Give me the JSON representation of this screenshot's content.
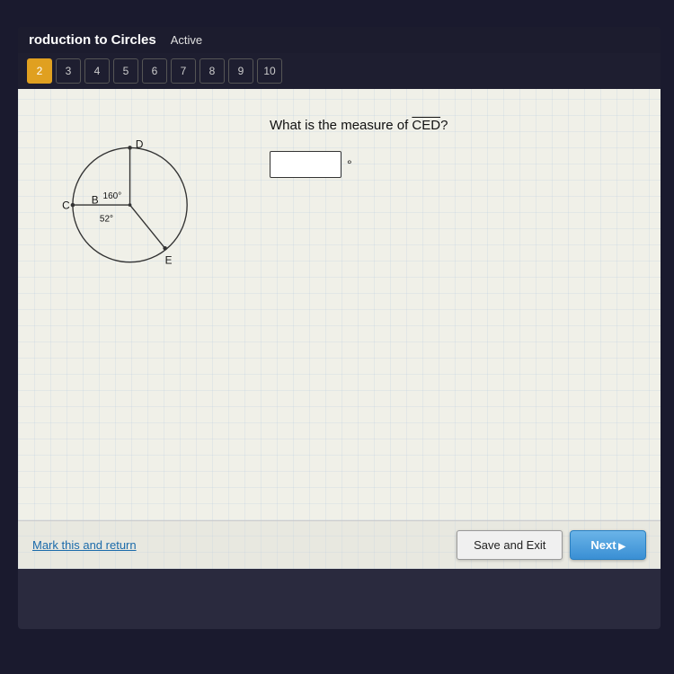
{
  "header": {
    "title": "roduction to Circles",
    "status": "Active"
  },
  "question_bar": {
    "numbers": [
      2,
      3,
      4,
      5,
      6,
      7,
      8,
      9,
      10
    ],
    "active": 2
  },
  "diagram": {
    "labels": {
      "D": "D",
      "B": "B",
      "C": "C",
      "E": "E",
      "angle1": "160°",
      "angle2": "52°"
    }
  },
  "question": {
    "text": "What is the measure of ",
    "angle": "CED",
    "suffix": "?",
    "answer_placeholder": ""
  },
  "degree_symbol": "°",
  "buttons": {
    "save_exit": "Save and Exit",
    "next": "Next"
  },
  "mark_return": "Mark this and return"
}
